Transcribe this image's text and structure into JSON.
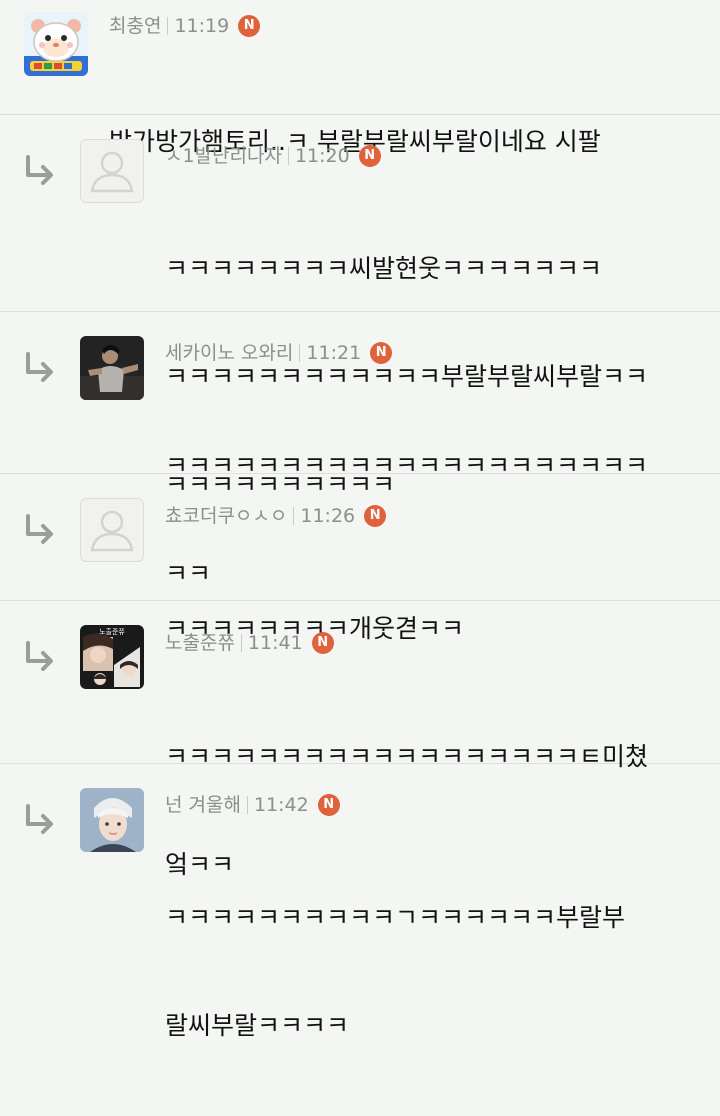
{
  "comments": [
    {
      "author": "최충연",
      "time": "11:19",
      "badge": "N",
      "lines": [
        "방가방가햄토리..ㅋ 부랄부랄씨부랄이네요 시팔"
      ],
      "reply": false,
      "avatar_icon": "hamster-avatar-icon"
    },
    {
      "author": "ㅅ1발난리나자",
      "time": "11:20",
      "badge": "N",
      "lines": [
        "ㅋㅋㅋㅋㅋㅋㅋㅋ씨발현웃ㅋㅋㅋㅋㅋㅋㅋ",
        "ㅋㅋㅋㅋㅋㅋㅋㅋㅋㅋㅋㅋ부랄부랄씨부랄ㅋㅋ",
        "ㅋㅋㅋㅋㅋㅋㅋㅋㅋㅋ"
      ],
      "reply": true,
      "avatar_icon": "default-user-avatar-icon"
    },
    {
      "author": "세카이노 오와리",
      "time": "11:21",
      "badge": "N",
      "lines": [
        "ㅋㅋㅋㅋㅋㅋㅋㅋㅋㅋㅋㅋㅋㅋㅋㅋㅋㅋㅋㅋㅋ",
        "ㅋㅋ"
      ],
      "reply": true,
      "avatar_icon": "dancer-photo-avatar-icon"
    },
    {
      "author": "쵸코더쿠ㅇㅅㅇ",
      "time": "11:26",
      "badge": "N",
      "lines": [
        "ㅋㅋㅋㅋㅋㅋㅋㅋ개웃겯ㅋㅋ"
      ],
      "reply": true,
      "avatar_icon": "default-user-avatar-icon"
    },
    {
      "author": "노출준쮸",
      "time": "11:41",
      "badge": "N",
      "lines": [
        "ㅋㅋㅋㅋㅋㅋㅋㅋㅋㅋㅋㅋㅋㅋㅋㅋㅋㅋㅌ미쳤",
        "엌ㅋㅋ"
      ],
      "reply": true,
      "avatar_icon": "collage-photo-avatar-icon",
      "avatar_caption": "노출준쮸"
    },
    {
      "author": "넌 겨울해",
      "time": "11:42",
      "badge": "N",
      "lines": [
        "ㅋㅋㅋㅋㅋㅋㅋㅋㅋㅋㄱㅋㅋㅋㅋㅋㅋ부랄부",
        "랄씨부랄ㅋㅋㅋㅋ"
      ],
      "reply": true,
      "avatar_icon": "portrait-photo-avatar-icon"
    }
  ],
  "colors": {
    "background": "#f3f6f2",
    "badge": "#e0623a",
    "meta_text": "#8c8f8b",
    "body_text": "#121212",
    "divider": "#dcdfdb",
    "reply_arrow": "#9a9d99"
  }
}
